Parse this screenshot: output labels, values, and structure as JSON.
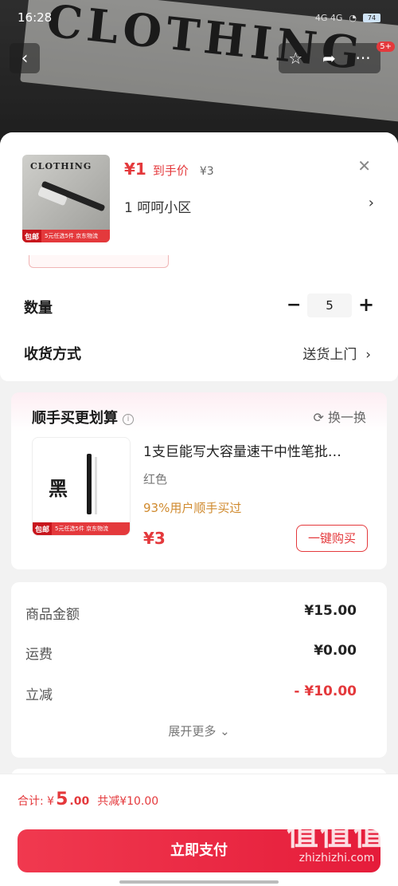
{
  "status_bar": {
    "time": "16:28",
    "network": "4G 4G",
    "battery": "74"
  },
  "header": {
    "backdrop_word": "CLOTHING",
    "more_badge": "5+"
  },
  "product": {
    "thumb_word": "CLOTHING",
    "thumb_tag_free": "包邮",
    "thumb_tag_text": "5元任选5件 京东物流",
    "price": "¥1",
    "price_label": "到手价",
    "orig_price": "¥3",
    "address": "1  呵呵小区"
  },
  "quantity": {
    "label": "数量",
    "value": "5"
  },
  "shipping": {
    "label": "收货方式",
    "value": "送货上门"
  },
  "recommend": {
    "title": "顺手买更划算",
    "swap_label": "换一换",
    "thumb_char": "黑",
    "thumb_tag_free": "包邮",
    "thumb_tag_text": "5元任选5件 京东物流",
    "name": "1支巨能写大容量速干中性笔批…",
    "color": "红色",
    "percent_text": "93%用户顺手买过",
    "price": "¥3",
    "buy_label": "一键购买"
  },
  "summary": {
    "rows": [
      {
        "label": "商品金额",
        "value": "¥15.00"
      },
      {
        "label": "运费",
        "value": "¥0.00"
      },
      {
        "label": "立减",
        "value": "- ¥10.00"
      }
    ],
    "expand_label": "展开更多"
  },
  "footer": {
    "total_label": "合计: ¥",
    "total_int": "5",
    "total_dec": ".00",
    "save_text": "共减¥10.00",
    "pay_label": "立即支付"
  },
  "watermark": {
    "big": "值值值",
    "small": "zhizhizhi.com"
  },
  "colors": {
    "accent": "#e4393c",
    "pay_button": "#e51c3a"
  }
}
